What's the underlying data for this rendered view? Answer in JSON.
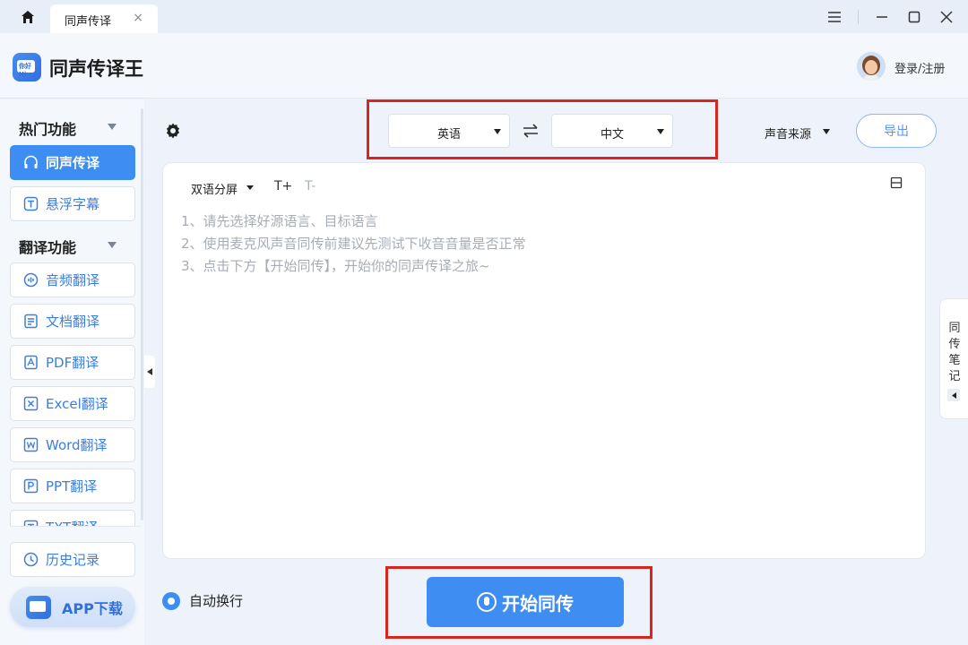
{
  "titlebar": {
    "tab_label": "同声传译",
    "tab_close": "×"
  },
  "header": {
    "brand": "同声传译王",
    "logo_text": "你好 Hi",
    "login": "登录/注册"
  },
  "sidebar": {
    "section1": "热门功能",
    "section2": "翻译功能",
    "items": [
      {
        "label": "同声传译",
        "icon": "headphones-icon",
        "active": true
      },
      {
        "label": "悬浮字幕",
        "icon": "subtitle-icon"
      },
      {
        "label": "音频翻译",
        "icon": "audio-wave-icon"
      },
      {
        "label": "文档翻译",
        "icon": "document-icon"
      },
      {
        "label": "PDF翻译",
        "icon": "pdf-icon"
      },
      {
        "label": "Excel翻译",
        "icon": "excel-icon"
      },
      {
        "label": "Word翻译",
        "icon": "word-icon"
      },
      {
        "label": "PPT翻译",
        "icon": "ppt-icon"
      },
      {
        "label": "TXT翻译",
        "icon": "txt-icon"
      },
      {
        "label": "历史记录",
        "icon": "clock-icon"
      }
    ],
    "app_download": "APP下载"
  },
  "toolbar": {
    "source_lang": "英语",
    "target_lang": "中文",
    "audio_source": "声音来源",
    "export": "导出"
  },
  "panel": {
    "view_mode": "双语分屏",
    "font_increase": "T+",
    "font_decrease": "T-",
    "hints": [
      "1、请先选择好源语言、目标语言",
      "2、使用麦克风声音同传前建议先测试下收音音量是否正常",
      "3、点击下方【开始同传】，开始你的同声传译之旅~"
    ]
  },
  "notes_tab": "同传笔记",
  "footer": {
    "auto_wrap": "自动换行",
    "start": "开始同传"
  },
  "colors": {
    "accent": "#3d8df2",
    "highlight_box": "#d8261f"
  }
}
